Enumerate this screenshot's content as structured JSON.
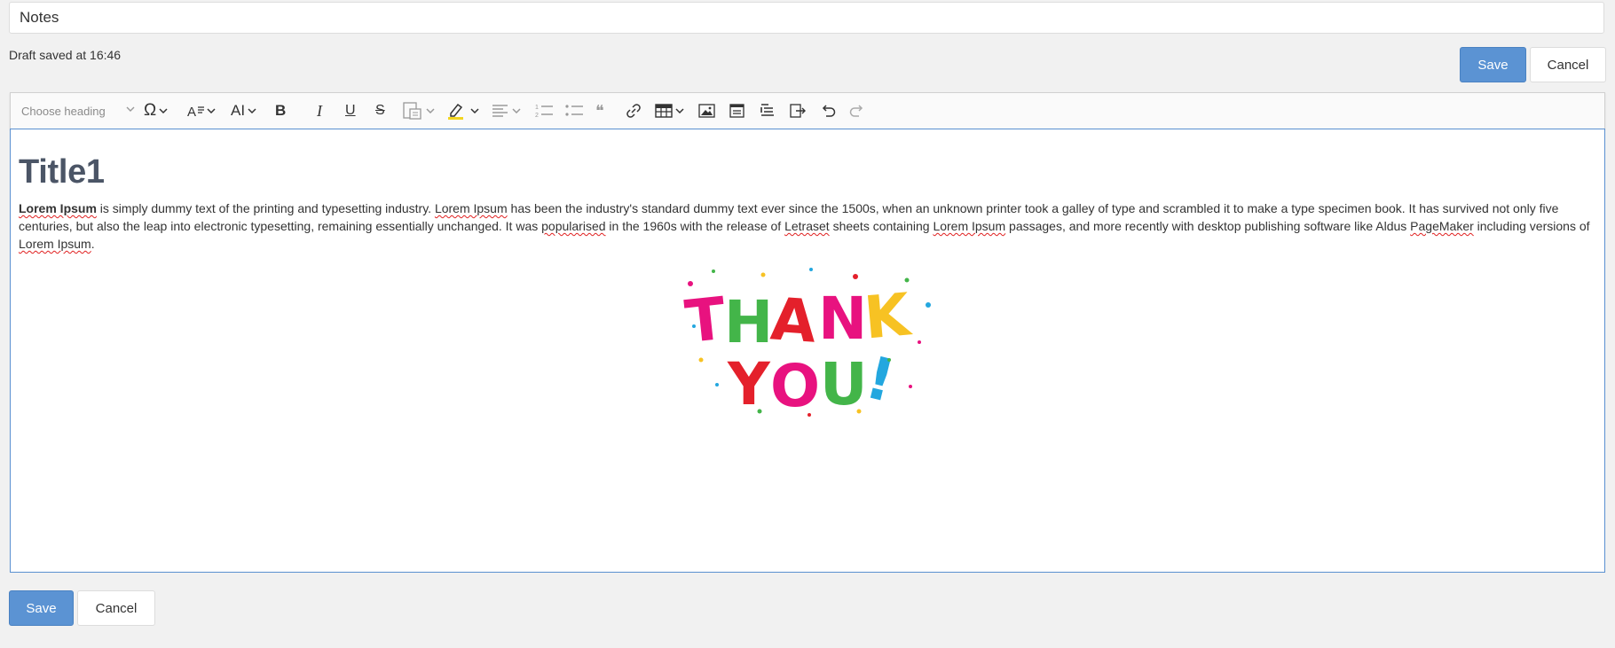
{
  "title_field": {
    "value": "Notes"
  },
  "status": {
    "draft_saved": "Draft saved at 16:46"
  },
  "buttons": {
    "save": "Save",
    "cancel": "Cancel"
  },
  "toolbar": {
    "heading_placeholder": "Choose heading",
    "items": [
      "heading-dropdown",
      "special-characters",
      "font-family",
      "font-size",
      "bold",
      "italic",
      "underline",
      "strikethrough",
      "paste-from-office",
      "highlight",
      "alignment",
      "numbered-list",
      "bulleted-list",
      "block-quote",
      "link",
      "insert-table",
      "insert-image",
      "page-break",
      "indent",
      "outdent",
      "undo",
      "redo"
    ],
    "glyphs": {
      "special": "Ω",
      "bold": "B",
      "italic": "I",
      "underline": "U",
      "strikethrough": "S",
      "font_size": "AI",
      "font_family": "A",
      "quote": "❝"
    }
  },
  "document": {
    "title": "Title1",
    "para": {
      "p1": "Lorem Ipsum",
      "p2": " is simply dummy text of the printing and typesetting industry. ",
      "p3": "Lorem Ipsum",
      "p4": " has been the industry's standard dummy text ever since the 1500s, when an unknown printer took a galley of type and scrambled it to make a type specimen book. It has survived not only five centuries, but also the leap into electronic typesetting, remaining essentially unchanged. It was ",
      "p5": "popularised",
      "p6": " in the 1960s with the release of ",
      "p7": "Letraset",
      "p8": " sheets containing ",
      "p9": "Lorem Ipsum",
      "p10": " passages, and more recently with desktop publishing software like Aldus ",
      "p11": "PageMaker",
      "p12": " including versions of ",
      "p13": "Lorem Ipsum",
      "p14": "."
    },
    "image_text": {
      "line1": "THANK",
      "line2": "YOU!"
    }
  },
  "colors": {
    "accent": "#5b93d3",
    "editor_border": "#5a90d0",
    "highlight_yellow": "#f2d51f",
    "art_pink": "#e8127f",
    "art_green": "#43b549",
    "art_red": "#e4202b",
    "art_yellow": "#f7c223",
    "art_blue": "#23a7df"
  }
}
